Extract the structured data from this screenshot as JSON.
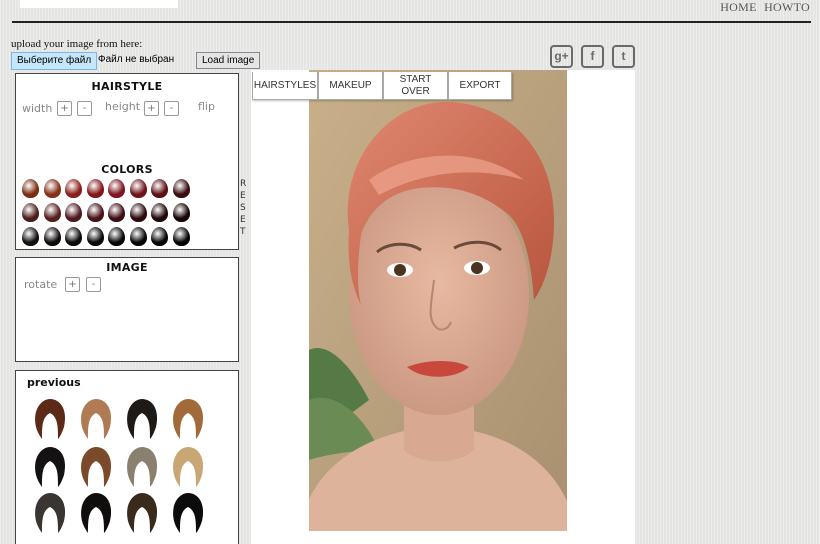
{
  "header": {
    "nav_home": "HOME",
    "nav_howto": "HOWTO"
  },
  "upload": {
    "label": "upload your image from here:",
    "choose_file_button": "Выберите файл",
    "file_status": "Файл не выбран",
    "load_button": "Load image"
  },
  "social": [
    {
      "icon": "google-plus-icon",
      "glyph": "g+"
    },
    {
      "icon": "facebook-icon",
      "glyph": "f"
    },
    {
      "icon": "twitter-icon",
      "glyph": "t"
    }
  ],
  "hairstyle_panel": {
    "title": "HAIRSTYLE",
    "width_label": "width",
    "height_label": "height",
    "flip_label": "flip",
    "plus": "+",
    "minus": "-",
    "colors_title": "COLORS",
    "reset_letters": [
      "R",
      "E",
      "S",
      "E",
      "T"
    ],
    "colors": [
      [
        "#7a2e12",
        "#84301a",
        "#8a1f1a",
        "#84171a",
        "#7d1620",
        "#6e1419",
        "#5b1015",
        "#3a0b10"
      ],
      [
        "#4b1e1a",
        "#551f1d",
        "#4f1820",
        "#4a1219",
        "#3d0e14",
        "#2c0a0e",
        "#200709",
        "#140405"
      ],
      [
        "#141010",
        "#100c0c",
        "#0e0b0b",
        "#0b0909",
        "#090707",
        "#070606",
        "#060505",
        "#050404"
      ]
    ]
  },
  "image_panel": {
    "title": "IMAGE",
    "rotate_label": "rotate",
    "plus": "+",
    "minus": "-"
  },
  "previous_panel": {
    "title": "previous",
    "hairstyles": [
      {
        "color": "#5c2a17"
      },
      {
        "color": "#b07a55"
      },
      {
        "color": "#1e1a18"
      },
      {
        "color": "#a26a3a"
      },
      {
        "color": "#141212"
      },
      {
        "color": "#7a4a2a"
      },
      {
        "color": "#8a8070"
      },
      {
        "color": "#c9a775"
      },
      {
        "color": "#3a3532"
      },
      {
        "color": "#100d0c"
      },
      {
        "color": "#3a2a1c"
      },
      {
        "color": "#0c0c0c"
      }
    ]
  },
  "tabs": [
    "HAIRSTYLES",
    "MAKEUP",
    "START OVER",
    "EXPORT"
  ]
}
